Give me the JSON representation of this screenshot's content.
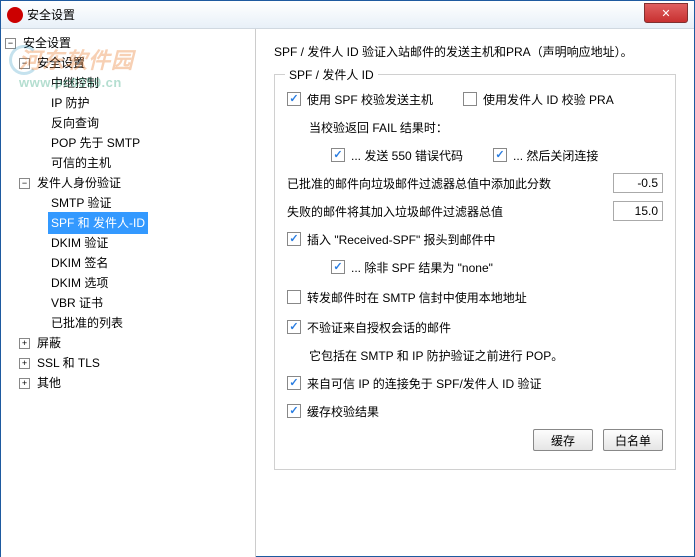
{
  "window": {
    "title": "安全设置",
    "close": "✕"
  },
  "watermark": {
    "text": "河东软件园",
    "url": "www.pc0359.cn"
  },
  "tree": {
    "root": {
      "label": "安全设置",
      "n1": {
        "label": "安全设置",
        "c1": "中继控制",
        "c2": "IP 防护",
        "c3": "反向查询",
        "c4": "POP 先于 SMTP",
        "c5": "可信的主机"
      },
      "n2": {
        "label": "发件人身份验证",
        "c1": "SMTP 验证",
        "c2": "SPF 和 发件人-ID",
        "c3": "DKIM 验证",
        "c4": "DKIM 签名",
        "c5": "DKIM 选项",
        "c6": "VBR 证书",
        "c7": "已批准的列表"
      },
      "n3": {
        "label": "屏蔽"
      },
      "n4": {
        "label": "SSL 和 TLS"
      },
      "n5": {
        "label": "其他"
      }
    }
  },
  "content": {
    "header": "SPF / 发件人 ID 验证入站邮件的发送主机和PRA（声明响应地址）。",
    "legend": "SPF / 发件人 ID",
    "chk_use_spf": "使用 SPF 校验发送主机",
    "chk_use_sender_id": "使用发件人 ID 校验 PRA",
    "label_fail": "当校验返回 FAIL 结果时：",
    "chk_send_550": "... 发送 550 错误代码",
    "chk_close_conn": "... 然后关闭连接",
    "label_approved_score": "已批准的邮件向垃圾邮件过滤器总值中添加此分数",
    "val_approved": "-0.5",
    "label_failed_score": "失败的邮件将其加入垃圾邮件过滤器总值",
    "val_failed": "15.0",
    "chk_insert_header": "插入 \"Received-SPF\" 报头到邮件中",
    "chk_unless_none": "... 除非 SPF 结果为 \"none\"",
    "chk_forward_local": "转发邮件时在 SMTP 信封中使用本地地址",
    "chk_no_verify_auth": "不验证来自授权会话的邮件",
    "label_includes": "它包括在 SMTP 和 IP 防护验证之前进行 POP。",
    "chk_trusted_exempt": "来自可信 IP 的连接免于 SPF/发件人 ID 验证",
    "chk_cache": "缓存校验结果",
    "btn_cache": "缓存",
    "btn_whitelist": "白名单"
  }
}
